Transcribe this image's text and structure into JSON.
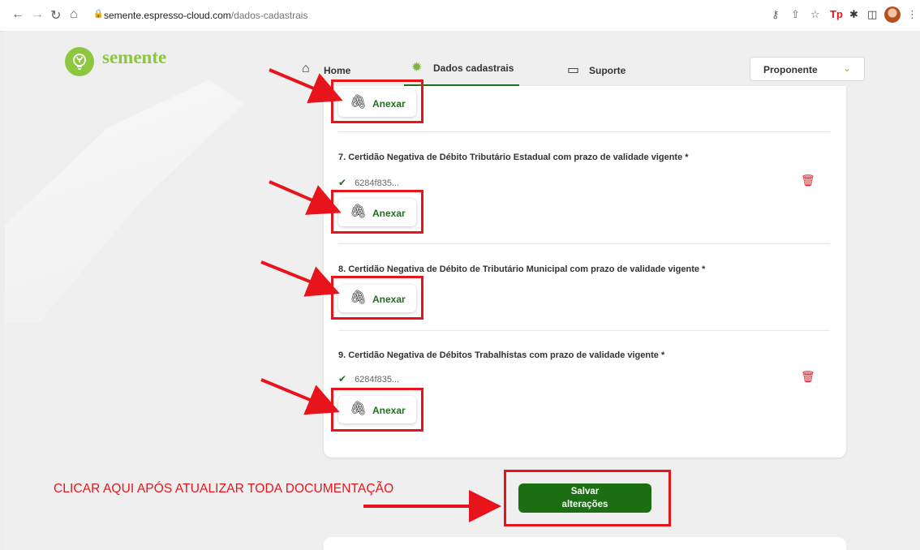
{
  "browser": {
    "url_host": "semente.espresso-cloud.com",
    "url_path": "/dados-cadastrais"
  },
  "header": {
    "logo_text": "semente",
    "menu": [
      {
        "label": "Home"
      },
      {
        "label": "Dados cadastrais"
      },
      {
        "label": "Suporte"
      }
    ],
    "role_select": "Proponente"
  },
  "documents": [
    {
      "title": "7. Certidão Negativa de Débito Tributário Estadual com prazo de validade vigente *",
      "file": "6284f835..."
    },
    {
      "title": "8. Certidão Negativa de Débito de Tributário Municipal com prazo de validade vigente *",
      "file": ""
    },
    {
      "title": "9. Certidão Negativa de Débitos Trabalhistas com prazo de validade vigente *",
      "file": "6284f835..."
    }
  ],
  "attach_label": "Anexar",
  "save": {
    "line1": "Salvar",
    "line2": "alterações"
  },
  "instruction": "CLICAR AQUI APÓS ATUALIZAR TODA DOCUMENTAÇÃO",
  "colors": {
    "brand_green": "#8dc63f",
    "primary": "#1c6e12",
    "annotation_red": "#e8141b",
    "delete_red": "#d9222a"
  }
}
